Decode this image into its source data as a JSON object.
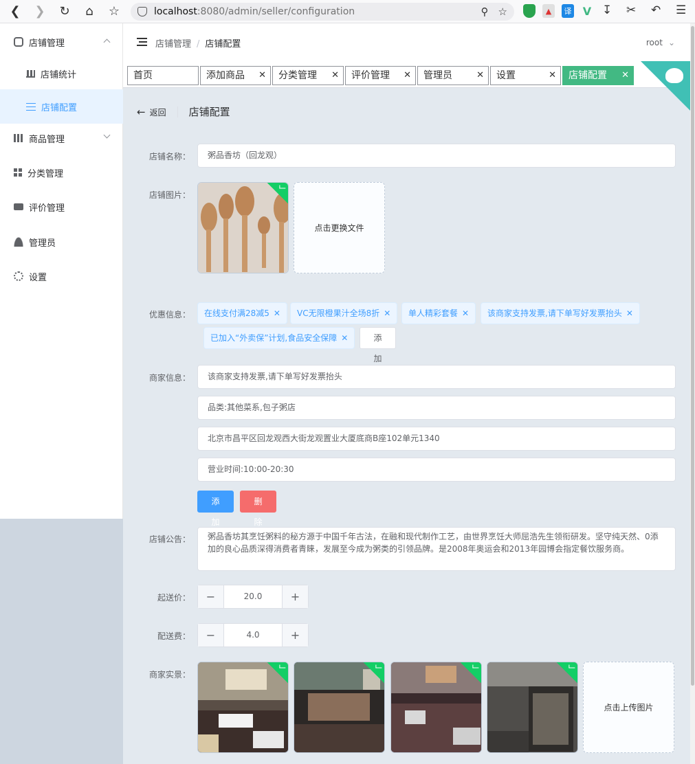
{
  "browser": {
    "url_host": "localhost",
    "url_path": ":8080/admin/seller/configuration",
    "ext_translate": "译"
  },
  "sidebar": {
    "items": [
      {
        "label": "店铺管理",
        "icon": "store-icon"
      },
      {
        "label": "店铺统计",
        "icon": "bar-chart-icon"
      },
      {
        "label": "店铺配置",
        "icon": "sliders-icon"
      },
      {
        "label": "商品管理",
        "icon": "goods-icon"
      },
      {
        "label": "分类管理",
        "icon": "grid-icon"
      },
      {
        "label": "评价管理",
        "icon": "comment-icon"
      },
      {
        "label": "管理员",
        "icon": "user-icon"
      },
      {
        "label": "设置",
        "icon": "gear-icon"
      }
    ]
  },
  "header": {
    "breadcrumb": [
      "店铺管理",
      "店铺配置"
    ],
    "breadcrumb_sep": "/",
    "user": "root"
  },
  "tabs": [
    {
      "label": "首页"
    },
    {
      "label": "添加商品"
    },
    {
      "label": "分类管理"
    },
    {
      "label": "评价管理"
    },
    {
      "label": "管理员"
    },
    {
      "label": "设置"
    },
    {
      "label": "店铺配置",
      "active": true
    }
  ],
  "page": {
    "back": "返回",
    "title": "店铺配置"
  },
  "form": {
    "name_label": "店铺名称：",
    "name_value": "粥品香坊（回龙观）",
    "image_label": "店铺图片：",
    "image_replace": "点击更换文件",
    "discount_label": "优惠信息：",
    "discounts": [
      "在线支付满28减5",
      "VC无限橙果汁全场8折",
      "单人精彩套餐",
      "该商家支持发票,请下单写好发票抬头",
      "已加入“外卖保”计划,食品安全保障"
    ],
    "discount_add": "添加",
    "info_label": "商家信息：",
    "infos": [
      "该商家支持发票,请下单写好发票抬头",
      "品类:其他菜系,包子粥店",
      "北京市昌平区回龙观西大街龙观置业大厦底商B座102单元1340",
      "营业时间:10:00-20:30"
    ],
    "info_add": "添加",
    "info_delete": "删除",
    "notice_label": "店铺公告：",
    "notice": "粥品香坊其烹饪粥料的秘方源于中国千年古法，在融和现代制作工艺，由世界烹饪大师屈浩先生领衔研发。坚守纯天然、0添加的良心品质深得消费者青睐，发展至今成为粥类的引领品牌。是2008年奥运会和2013年园博会指定餐饮服务商。",
    "min_price_label": "起送价：",
    "min_price": "20.0",
    "delivery_label": "配送费：",
    "delivery": "4.0",
    "minus": "−",
    "plus": "+",
    "photos_label": "商家实景：",
    "photos_upload": "点击上传图片"
  },
  "colors": {
    "accent": "#409eff",
    "active_tab": "#42b983",
    "danger": "#f56c6c",
    "success": "#13ce66"
  }
}
